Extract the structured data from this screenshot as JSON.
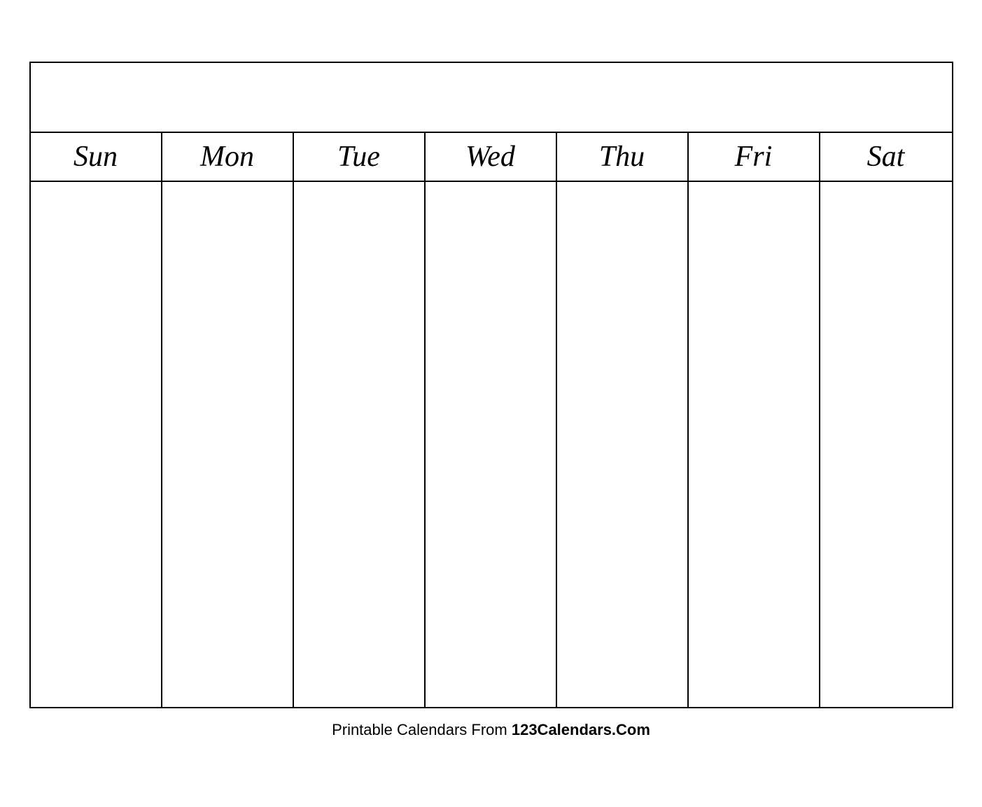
{
  "calendar": {
    "title": "",
    "days": [
      "Sun",
      "Mon",
      "Tue",
      "Wed",
      "Thu",
      "Fri",
      "Sat"
    ],
    "rows": 5,
    "footer_normal": "Printable Calendars From ",
    "footer_bold": "123Calendars.Com"
  }
}
